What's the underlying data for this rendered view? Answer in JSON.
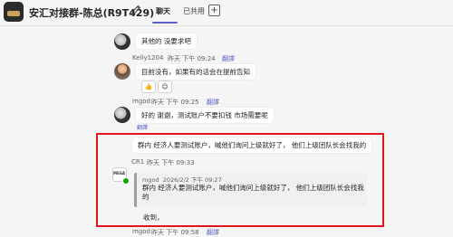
{
  "header": {
    "title": "安汇对接群-陈总(R9T429)",
    "tabs": [
      {
        "label": "聊天"
      },
      {
        "label": "已共用"
      }
    ],
    "add_tab_symbol": "+"
  },
  "messages": [
    {
      "sender": "",
      "time": "",
      "text": "其他的 没要求吧"
    },
    {
      "sender": "Kelly1204",
      "time": "昨天 下午 09:24",
      "translate": "翻譯",
      "text": "目前没有，如果有的话会在提前告知",
      "reaction": "👍"
    },
    {
      "sender": "mgod",
      "time": "昨天 下午 09:25",
      "translate": "翻譯",
      "text": "好的 谢谢，测试账户不要扣钱 市场需要呢"
    },
    {
      "sender": "",
      "time": "",
      "text": "群内 经济人要测试账户，喊他们询问上级就好了， 他们上级团队长会找我的"
    },
    {
      "sender": "CR1",
      "time": "昨天 下午 09:33",
      "quote": {
        "sender": "mgod",
        "time": "2026/2/2 下午 09:27",
        "text": "群内 经济人要测试账户，喊他们询问上级就好了， 他们上级团队长会找我的"
      },
      "text": "收到，",
      "avatar_text": "MEGA"
    },
    {
      "sender": "mgod",
      "time": "昨天 下午 09:58",
      "translate": "翻譯"
    }
  ],
  "edge_link": "翻譯"
}
